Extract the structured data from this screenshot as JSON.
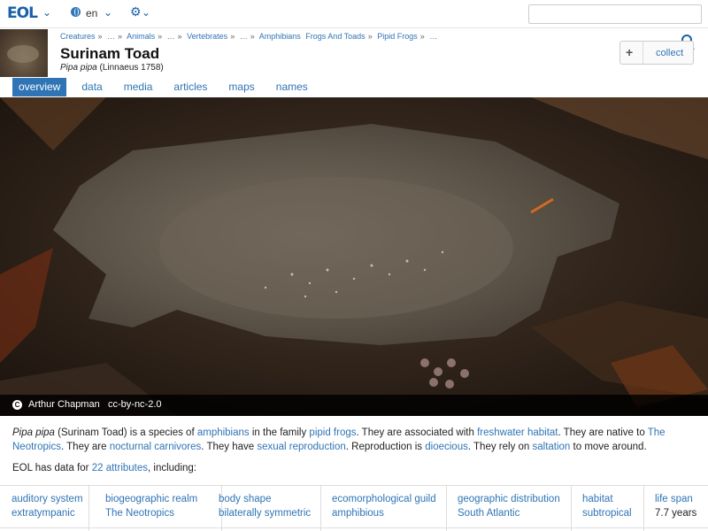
{
  "topbar": {
    "logo": "EOL",
    "language": "en",
    "search_placeholder": ""
  },
  "header": {
    "breadcrumb": [
      "Creatures",
      "…",
      "Animals",
      "…",
      "Vertebrates",
      "…",
      "Amphibians",
      "Frogs And Toads",
      "Pipid Frogs",
      "…"
    ],
    "breadcrumb_sep": "»",
    "title": "Surinam Toad",
    "scientific_name": "Pipa pipa",
    "authority": "(Linnaeus 1758)",
    "collect_plus": "+",
    "collect_label": "collect"
  },
  "tabs": [
    "overview",
    "data",
    "media",
    "articles",
    "maps",
    "names"
  ],
  "hero": {
    "author": "Arthur Chapman",
    "license": "cc-by-nc-2.0",
    "cc_glyph": "C"
  },
  "summary": {
    "sci": "Pipa pipa",
    "t1": " (Surinam Toad) is a species of ",
    "l1": "amphibians",
    "t2": " in the family ",
    "l2": "pipid frogs",
    "t3": ". They are associated with ",
    "l3": "freshwater habitat",
    "t4": ". They are native to ",
    "l4": "The Neotropics",
    "t5": ". They are ",
    "l5": "nocturnal carnivores",
    "t6": ". They have ",
    "l6": "sexual reproduction",
    "t7": ". Reproduction is ",
    "l7": "dioecious",
    "t8": ". They rely on ",
    "l8": "saltation",
    "t9": " to move around."
  },
  "data_line": {
    "prefix": "EOL has data for ",
    "link": "22 attributes",
    "suffix": ", including:"
  },
  "attributes": [
    {
      "name": "auditory system",
      "value": "extratympanic"
    },
    {
      "name": "biogeographic realm",
      "value": "The Neotropics"
    },
    {
      "name": "body shape",
      "value": "bilaterally symmetric"
    },
    {
      "name": "ecomorphological guild",
      "value": "amphibious"
    },
    {
      "name": "geographic distribution",
      "value": "South Atlantic"
    },
    {
      "name": "habitat",
      "value": "subtropical"
    },
    {
      "name": "life span",
      "value": "7.7 years"
    }
  ],
  "colors": {
    "link": "#2f74b5",
    "tab_active": "#2f74b5"
  }
}
